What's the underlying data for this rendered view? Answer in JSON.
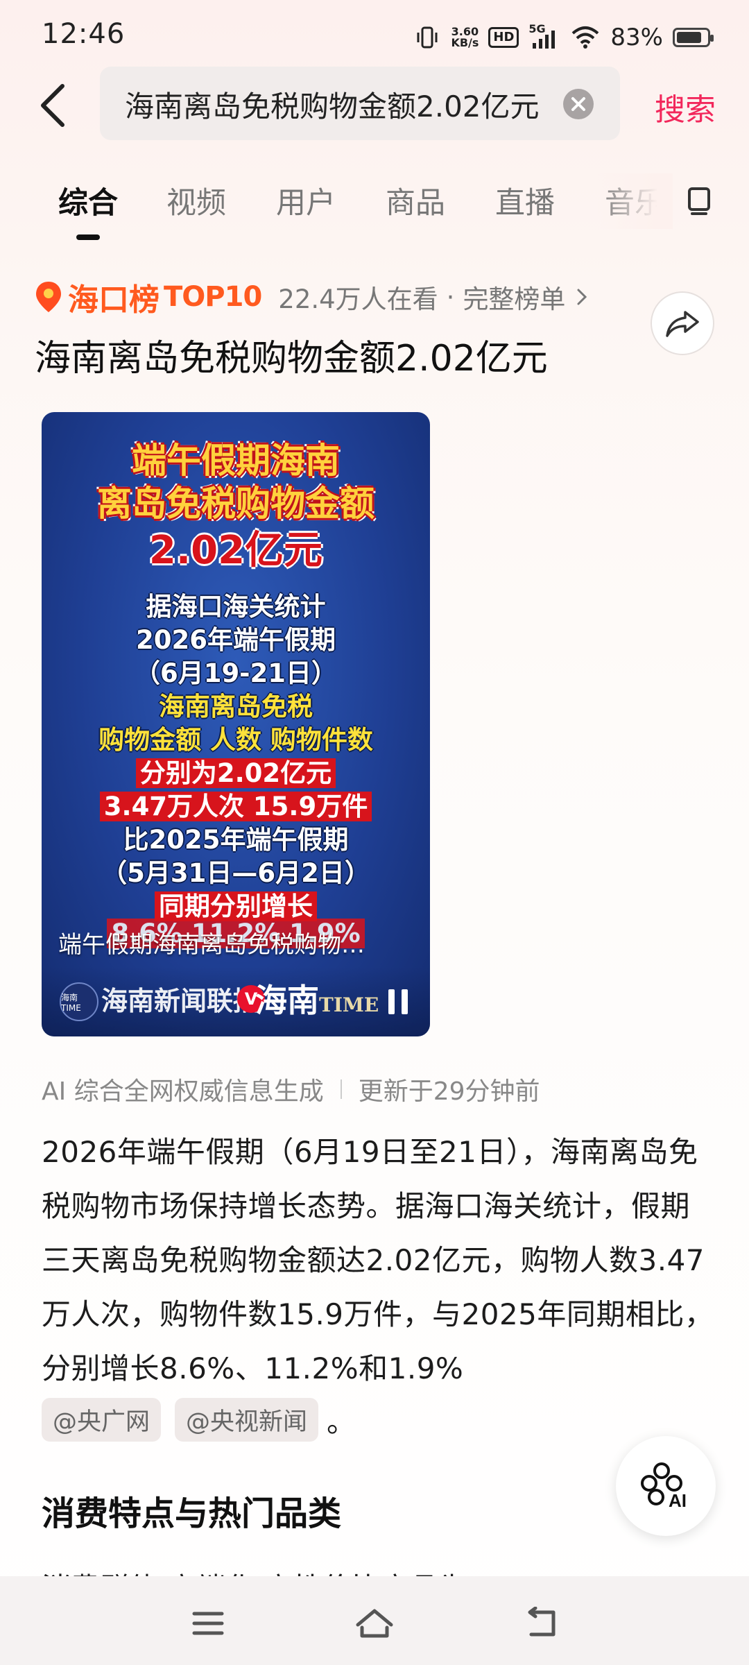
{
  "status_bar": {
    "time": "12:46",
    "net_speed_value": "3.60",
    "net_speed_unit": "KB/s",
    "hd_label": "HD",
    "network_label": "5G",
    "battery_percent": "83%",
    "battery_level": 0.83
  },
  "search": {
    "query": "海南离岛免税购物金额2.02亿元",
    "button_label": "搜索"
  },
  "tabs": [
    {
      "label": "综合",
      "active": true
    },
    {
      "label": "视频"
    },
    {
      "label": "用户"
    },
    {
      "label": "商品"
    },
    {
      "label": "直播"
    },
    {
      "label": "音乐"
    }
  ],
  "ranking": {
    "name": "海口榜",
    "rank": "TOP10",
    "viewers": "22.4万人在看",
    "separator": "·",
    "link_label": "完整榜单"
  },
  "headline": "海南离岛免税购物金额2.02亿元",
  "video": {
    "title_line1": "端午假期海南",
    "title_line2": "离岛免税购物金额",
    "title_line3": "2.02亿元",
    "lines": [
      "据海口海关统计",
      "2026年端午假期",
      "（6月19-21日）",
      "海南离岛免税",
      "购物金额 人数 购物件数",
      "分别为2.02亿元",
      "3.47万人次 15.9万件",
      "比2025年端午假期",
      "（5月31日—6月2日）",
      "同期分别增长",
      "8.6% 11.2% 1.9%"
    ],
    "caption": "端午假期海南离岛免税购物…",
    "channel_badge": "海南TIME",
    "channel_1": "海南新闻联播",
    "channel_2_main": "海南",
    "channel_2_sub": "TIME",
    "verified_label": "V"
  },
  "source": {
    "label": "AI 综合全网权威信息生成",
    "updated": "更新于29分钟前"
  },
  "body_text": "2026年端午假期（6月19日至21日），海南离岛免税购物市场保持增长态势。据海口海关统计，假期三天离岛免税购物金额达2.02亿元，购物人数3.47万人次，购物件数15.9万件，与2025年同期相比，分别增长8.6%、11.2%和1.9%",
  "references": [
    "@央广网",
    "@央视新闻"
  ],
  "reference_end": "。",
  "section_title": "消费特点与热门品类",
  "cut_text": "消费群体  高端化  高性价比商品为",
  "ai_fab_label": "AI",
  "colors": {
    "accent": "#f2275b",
    "rank_orange": "#ff5a1f",
    "video_blue": "#1f3f94",
    "video_yellow": "#ffd23d",
    "video_red": "#d8131b"
  }
}
